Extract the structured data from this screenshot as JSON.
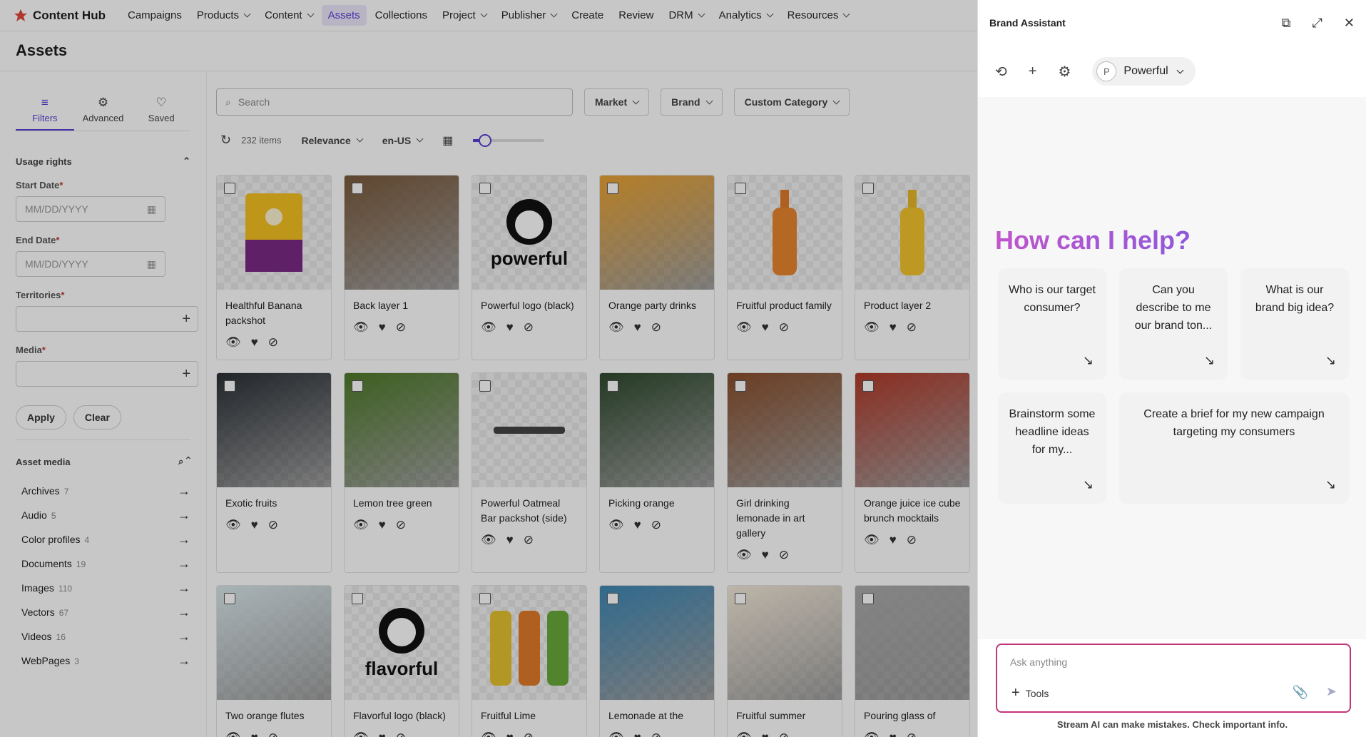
{
  "app": {
    "logo": "Content Hub",
    "nav": [
      {
        "label": "Campaigns",
        "has_menu": false
      },
      {
        "label": "Products",
        "has_menu": true
      },
      {
        "label": "Content",
        "has_menu": true
      },
      {
        "label": "Assets",
        "has_menu": false,
        "active": true
      },
      {
        "label": "Collections",
        "has_menu": false
      },
      {
        "label": "Project",
        "has_menu": true
      },
      {
        "label": "Publisher",
        "has_menu": true
      },
      {
        "label": "Create",
        "has_menu": false
      },
      {
        "label": "Review",
        "has_menu": false
      },
      {
        "label": "DRM",
        "has_menu": true
      },
      {
        "label": "Analytics",
        "has_menu": true
      },
      {
        "label": "Resources",
        "has_menu": true
      }
    ],
    "accent": "#5b3fd6"
  },
  "page": {
    "title": "Assets"
  },
  "filters": {
    "tabs": [
      "Filters",
      "Advanced",
      "Saved"
    ],
    "usage_rights": "Usage rights",
    "start_date_label": "Start Date",
    "end_date_label": "End Date",
    "date_placeholder": "MM/DD/YYYY",
    "territories_label": "Territories",
    "media_label": "Media",
    "apply": "Apply",
    "clear": "Clear",
    "asset_media": "Asset media",
    "media_types": [
      {
        "name": "Archives",
        "count": "7"
      },
      {
        "name": "Audio",
        "count": "5"
      },
      {
        "name": "Color profiles",
        "count": "4"
      },
      {
        "name": "Documents",
        "count": "19"
      },
      {
        "name": "Images",
        "count": "110"
      },
      {
        "name": "Vectors",
        "count": "67"
      },
      {
        "name": "Videos",
        "count": "16"
      },
      {
        "name": "WebPages",
        "count": "3"
      }
    ]
  },
  "toolbar": {
    "search_placeholder": "Search",
    "market": "Market",
    "brand": "Brand",
    "custom_category": "Custom Category",
    "count": "232 items",
    "sort": "Relevance",
    "locale": "en-US"
  },
  "assets": [
    {
      "title": "Healthful Banana packshot",
      "art": "bag"
    },
    {
      "title": "Back layer 1",
      "art": "scene-brown"
    },
    {
      "title": "Powerful logo (black)",
      "art": "logo-powerful"
    },
    {
      "title": "Orange party drinks",
      "art": "scene-orange"
    },
    {
      "title": "Fruitful product family",
      "art": "bottle-orange"
    },
    {
      "title": "Product layer 2",
      "art": "bottle-yellow"
    },
    {
      "title": "Exotic fruits",
      "art": "scene-dark"
    },
    {
      "title": "Lemon tree green",
      "art": "scene-green"
    },
    {
      "title": "Powerful Oatmeal Bar packshot (side)",
      "art": "bar"
    },
    {
      "title": "Picking orange",
      "art": "scene-deepgreen"
    },
    {
      "title": "Girl drinking lemonade in art gallery",
      "art": "scene-warm"
    },
    {
      "title": "Orange juice ice cube brunch mocktails",
      "art": "scene-red"
    },
    {
      "title": "Two orange flutes",
      "art": "scene-light"
    },
    {
      "title": "Flavorful logo (black)",
      "art": "logo-flavorful"
    },
    {
      "title": "Fruitful Lime",
      "art": "bottles"
    },
    {
      "title": "Lemonade at the",
      "art": "scene-sky"
    },
    {
      "title": "Fruitful summer",
      "art": "scene-citrus"
    },
    {
      "title": "Pouring glass of",
      "art": "scene-grey"
    }
  ],
  "assistant": {
    "title": "Brand Assistant",
    "agent": "Powerful",
    "agent_initial": "P",
    "headline": "How can I help?",
    "suggestions": [
      "Who is our target consumer?",
      "Can you describe to me our brand ton...",
      "What is our brand big idea?",
      "Brainstorm some headline ideas for my...",
      "Create a brief for my new campaign targeting my consumers"
    ],
    "input_placeholder": "Ask anything",
    "tools": "Tools",
    "disclaimer": "Stream AI can make mistakes. Check important info."
  }
}
